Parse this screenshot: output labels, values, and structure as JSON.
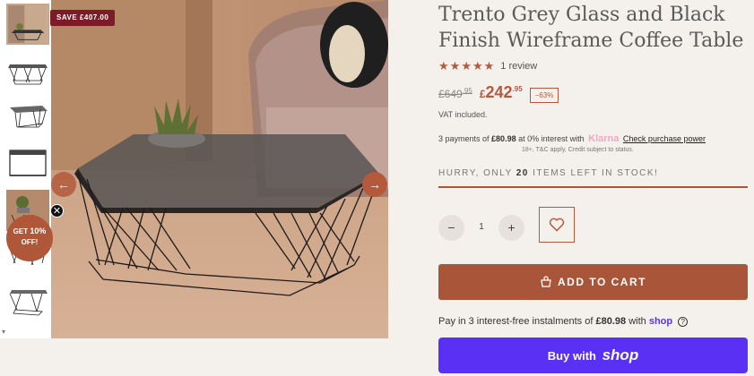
{
  "gallery": {
    "save_badge": "SAVE £407.00",
    "prev_icon": "arrow-left-icon",
    "next_icon": "arrow-right-icon",
    "thumbnail_count": 7,
    "scroll_indicator": "▾"
  },
  "promo": {
    "line1": "GET",
    "percent": "10%",
    "line2": "OFF!",
    "close": "✕"
  },
  "product": {
    "title": "Trento Grey Glass and Black Finish Wireframe Coffee Table",
    "rating_stars": 5,
    "review_count": "1 review",
    "old_price_main": "£649",
    "old_price_cents": ".95",
    "new_price_currency": "£",
    "new_price_main": "242",
    "new_price_cents": ".95",
    "discount": "−63%",
    "vat": "VAT included.",
    "colors": {
      "accent": "#b4593c",
      "badge": "#7d1b28",
      "shop": "#5a31f4"
    }
  },
  "klarna": {
    "prefix": "3 payments of",
    "amount": "£80.98",
    "middle": "at 0% interest with",
    "logo": "Klarna",
    "link": "Check purchase power",
    "note": "18+, T&C apply, Credit subject to status."
  },
  "stock": {
    "prefix": "HURRY, ONLY",
    "count": "20",
    "suffix": "ITEMS LEFT IN STOCK!"
  },
  "quantity": {
    "minus": "−",
    "value": "1",
    "plus": "+"
  },
  "actions": {
    "add_to_cart": "ADD TO CART",
    "shop_pay_prefix": "Pay in 3 interest-free instalments of",
    "shop_pay_amount": "£80.98",
    "shop_pay_with": "with",
    "shop_word": "shop",
    "help": "?",
    "buy_with": "Buy with",
    "buy_logo": "shop"
  }
}
